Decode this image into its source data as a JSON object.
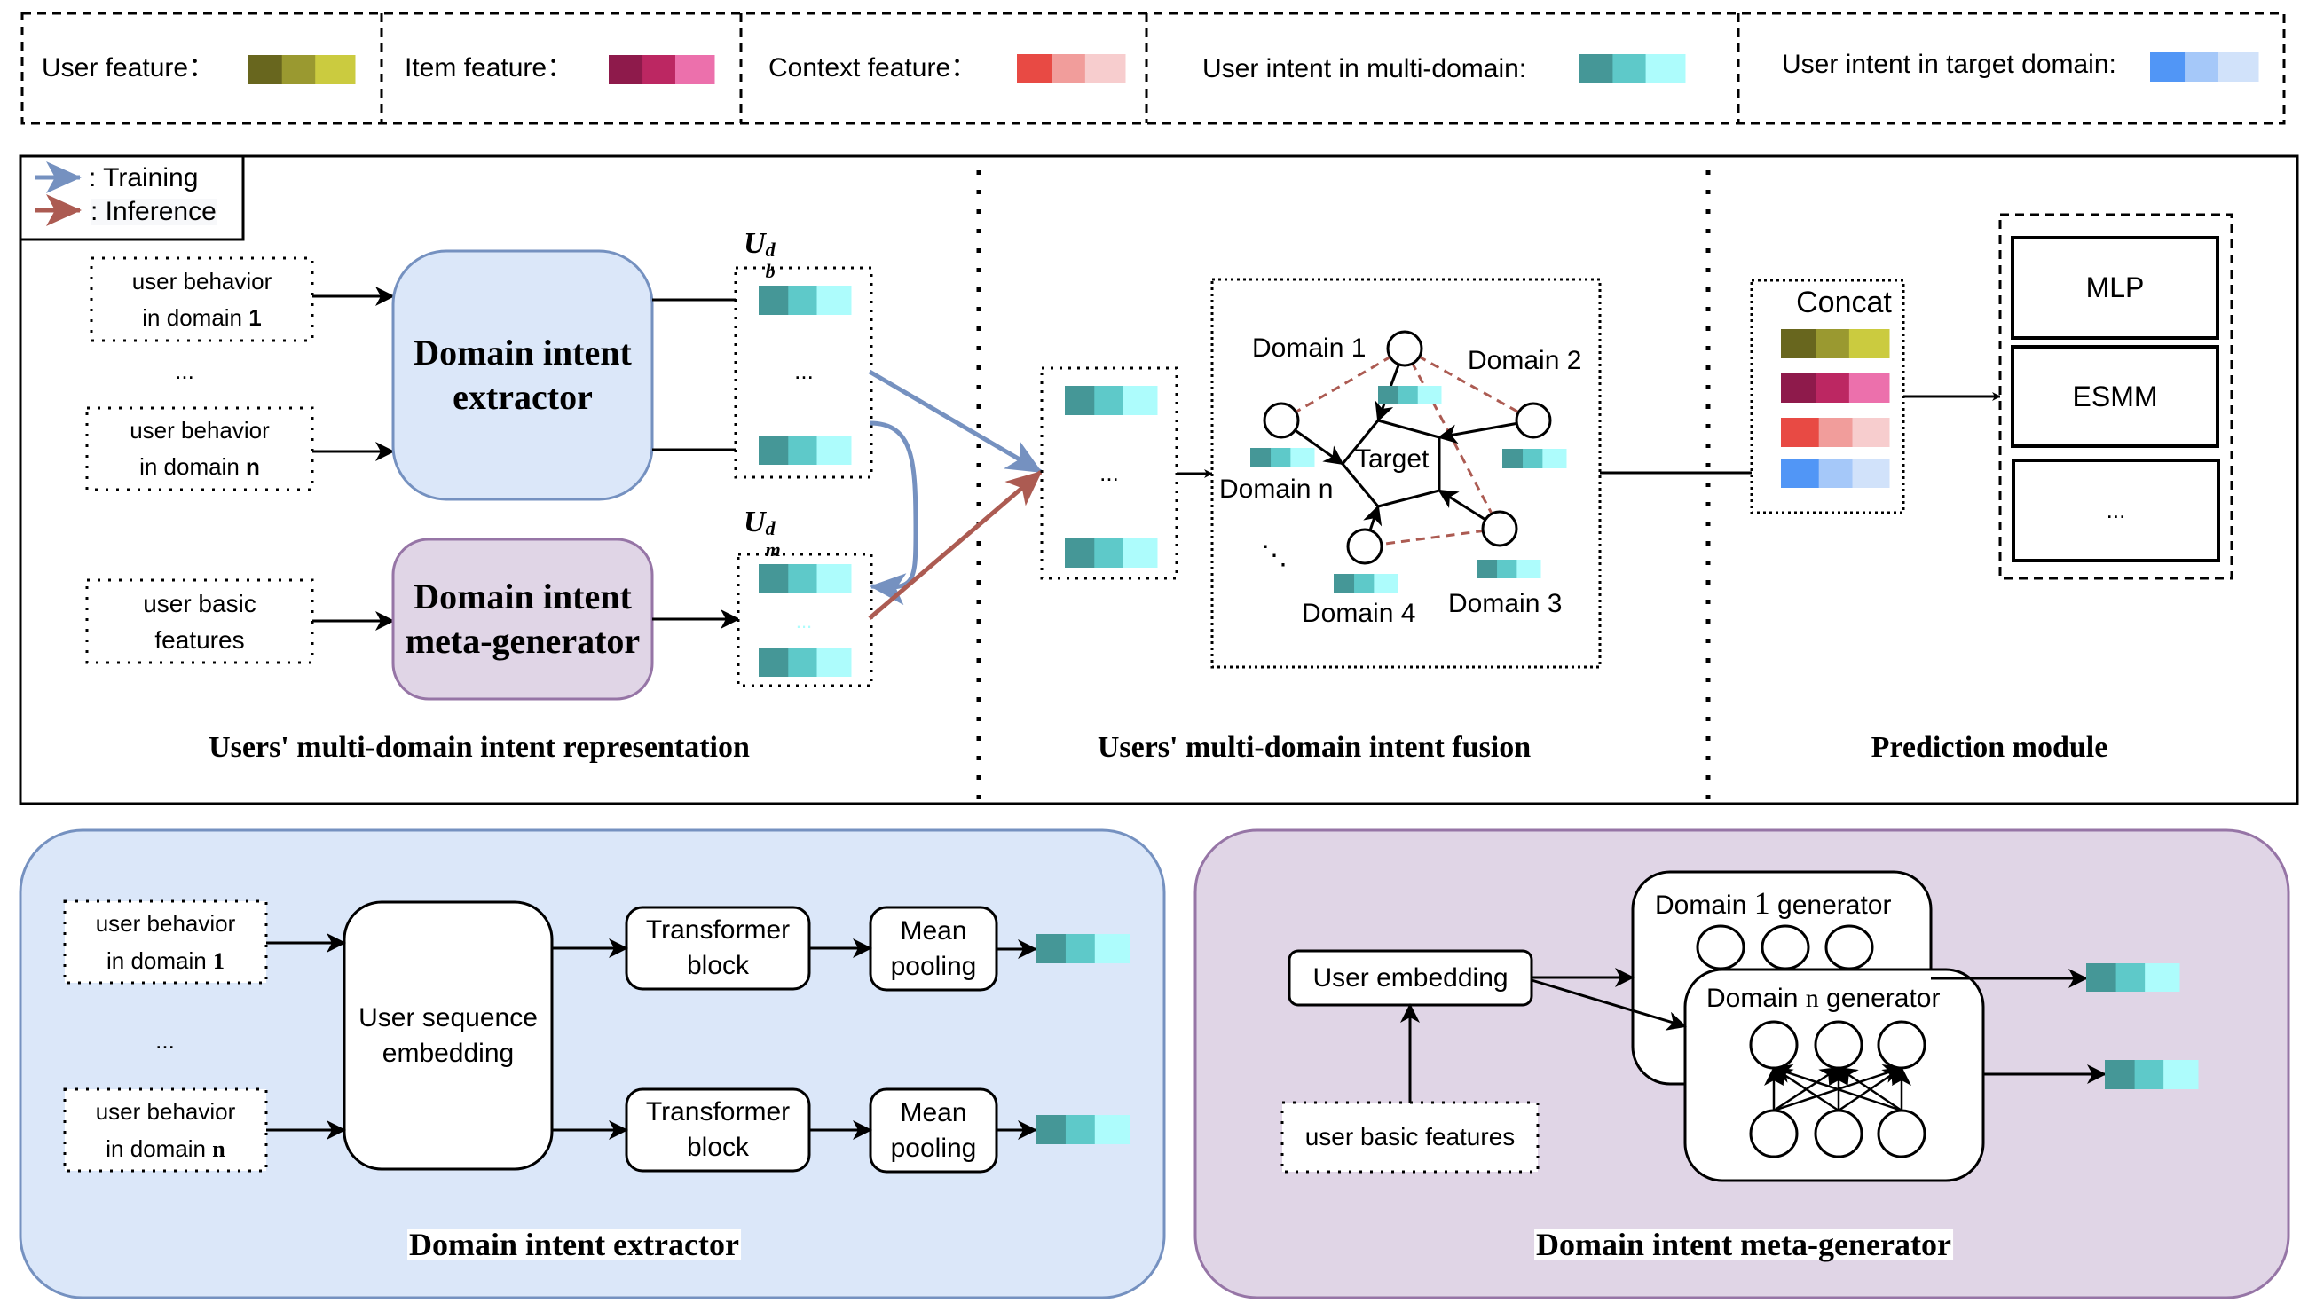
{
  "colors": {
    "user_feature": [
      "#68661e",
      "#9a9930",
      "#cbcb3f"
    ],
    "item_feature": [
      "#8e1a4b",
      "#bc2762",
      "#ec70ac"
    ],
    "context_feature": [
      "#e84a44",
      "#f19d9b",
      "#f7cdce"
    ],
    "intent_multi_domain": [
      "#459797",
      "#5ec9c9",
      "#adfcfc"
    ],
    "intent_target_domain": [
      "#5196f6",
      "#a5c8f9",
      "#d1e2fa"
    ],
    "training_arrow": "#7591c0",
    "inference_arrow": "#ac5b52",
    "extractor_fill": "#dbe7f9",
    "extractor_stroke": "#7591c0",
    "metagen_fill": "#e0d5e6",
    "metagen_stroke": "#9675a6",
    "graph_dashed_edge": "#ac5b52"
  },
  "legend_bar": [
    {
      "label": "User feature：",
      "swatch": "user_feature"
    },
    {
      "label": "Item feature：",
      "swatch": "item_feature"
    },
    {
      "label": "Context feature：",
      "swatch": "context_feature"
    },
    {
      "label": "User intent in multi-domain:",
      "swatch": "intent_multi_domain"
    },
    {
      "label": "User intent in target domain:",
      "swatch": "intent_target_domain"
    }
  ],
  "arrow_legend": {
    "training": ": Training",
    "inference": ": Inference"
  },
  "representation": {
    "behavior_1": {
      "line1": "user behavior",
      "line2_prefix": "in domain ",
      "line2_index": "1"
    },
    "ellipsis": "...",
    "behavior_n": {
      "line1": "user behavior",
      "line2_prefix": "in domain ",
      "line2_index": "n"
    },
    "basic_features": {
      "line1": "user basic",
      "line2": "features"
    },
    "extractor": {
      "line1": "Domain intent",
      "line2": "extractor"
    },
    "meta_generator": {
      "line1": "Domain intent",
      "line2": "meta-generator"
    },
    "ub_label": {
      "base": "U",
      "sup": "d",
      "sub": "b"
    },
    "um_label": {
      "base": "U",
      "sup": "d",
      "sub": "m"
    },
    "vector_ellipsis": "...",
    "title": "Users' multi-domain intent representation"
  },
  "fusion": {
    "stack_ellipsis": "...",
    "nodes": {
      "d1": "Domain 1",
      "d2": "Domain 2",
      "d3": "Domain 3",
      "d4": "Domain 4",
      "dn": "Domain n",
      "target": "Target",
      "more": "⋱"
    },
    "title": "Users' multi-domain intent fusion"
  },
  "prediction": {
    "concat": "Concat",
    "models": [
      "MLP",
      "ESMM",
      "..."
    ],
    "title": "Prediction module"
  },
  "extractor_detail": {
    "behavior_1": {
      "line1": "user behavior",
      "line2_prefix": "in domain ",
      "line2_index": "1"
    },
    "ellipsis": "...",
    "behavior_n": {
      "line1": "user behavior",
      "line2_prefix": "in domain ",
      "line2_index": "n"
    },
    "sequence_embedding": {
      "line1": "User sequence",
      "line2": "embedding"
    },
    "transformer": {
      "line1": "Transformer",
      "line2": "block"
    },
    "pooling": {
      "line1": "Mean",
      "line2": "pooling"
    },
    "title": "Domain intent extractor"
  },
  "metagen_detail": {
    "user_embedding": "User embedding",
    "basic_features": "user basic features",
    "gen_1": {
      "prefix": "Domain ",
      "index": "1",
      "suffix": " generator"
    },
    "gen_n": {
      "prefix": "Domain ",
      "index": "n",
      "suffix": " generator"
    },
    "title": "Domain intent meta-generator"
  }
}
